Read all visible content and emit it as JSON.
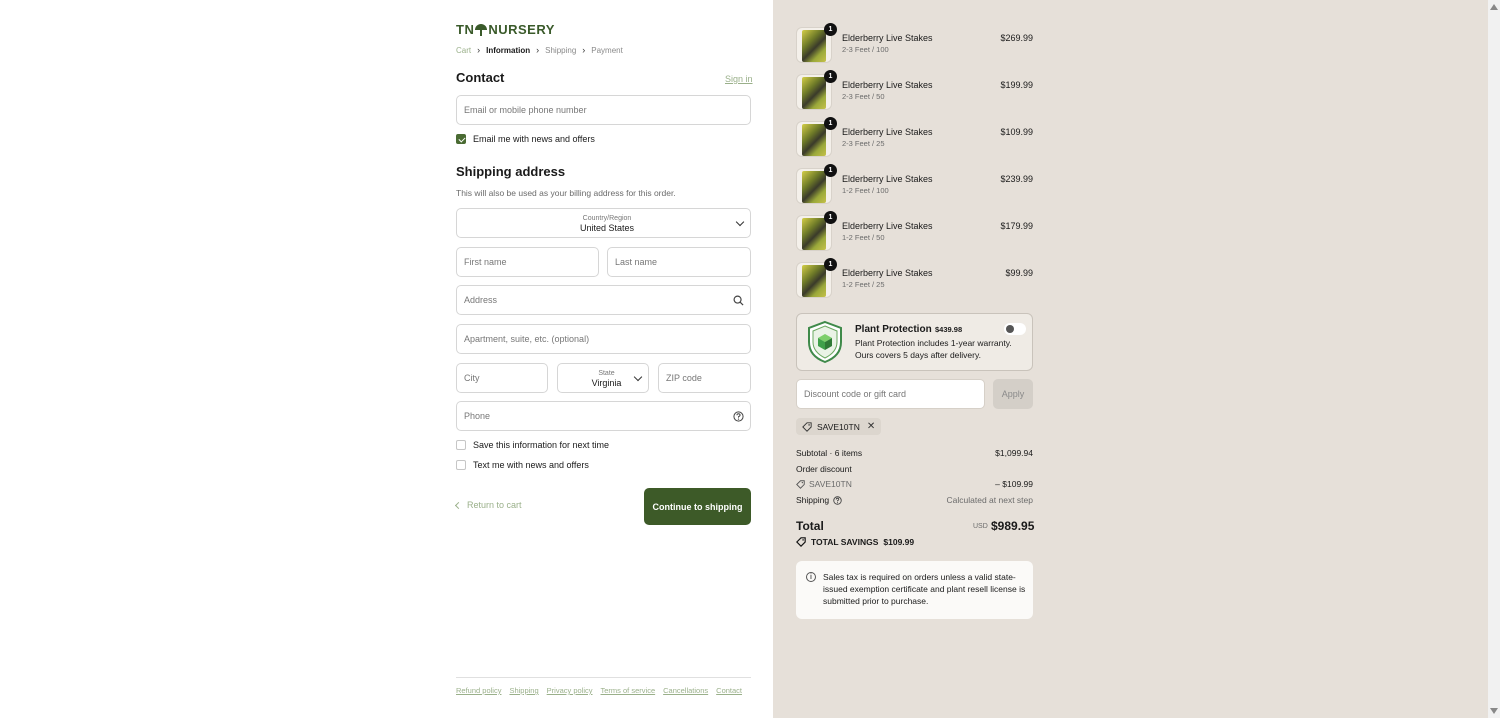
{
  "brand": {
    "logo_left": "TN",
    "logo_right": "NURSERY"
  },
  "breadcrumb": {
    "cart": "Cart",
    "information": "Information",
    "shipping": "Shipping",
    "payment": "Payment"
  },
  "contact": {
    "heading": "Contact",
    "sign_in": "Sign in",
    "email_placeholder": "Email or mobile phone number",
    "email_news_label": "Email me with news and offers",
    "email_news_checked": true
  },
  "shipping_address": {
    "heading": "Shipping address",
    "note": "This will also be used as your billing address for this order.",
    "country_label": "Country/Region",
    "country_value": "United States",
    "first_name_placeholder": "First name",
    "last_name_placeholder": "Last name",
    "address_placeholder": "Address",
    "apartment_placeholder": "Apartment, suite, etc. (optional)",
    "city_placeholder": "City",
    "state_label": "State",
    "state_value": "Virginia",
    "zip_placeholder": "ZIP code",
    "phone_placeholder": "Phone",
    "save_info_label": "Save this information for next time",
    "text_news_label": "Text me with news and offers"
  },
  "actions": {
    "return_label": "Return to cart",
    "continue_label": "Continue to shipping"
  },
  "footer": {
    "links": [
      "Refund policy",
      "Shipping",
      "Privacy policy",
      "Terms of service",
      "Cancellations",
      "Contact"
    ]
  },
  "order": {
    "items": [
      {
        "qty": "1",
        "name": "Elderberry Live Stakes",
        "variant": "2-3 Feet / 100",
        "price": "$269.99"
      },
      {
        "qty": "1",
        "name": "Elderberry Live Stakes",
        "variant": "2-3 Feet / 50",
        "price": "$199.99"
      },
      {
        "qty": "1",
        "name": "Elderberry Live Stakes",
        "variant": "2-3 Feet / 25",
        "price": "$109.99"
      },
      {
        "qty": "1",
        "name": "Elderberry Live Stakes",
        "variant": "1-2 Feet / 100",
        "price": "$239.99"
      },
      {
        "qty": "1",
        "name": "Elderberry Live Stakes",
        "variant": "1-2 Feet / 50",
        "price": "$179.99"
      },
      {
        "qty": "1",
        "name": "Elderberry Live Stakes",
        "variant": "1-2 Feet / 25",
        "price": "$99.99"
      }
    ],
    "protection": {
      "title": "Plant Protection",
      "price": "$439.98",
      "desc_line1": "Plant Protection includes 1-year warranty.",
      "desc_line2": "Ours covers 5 days after delivery.",
      "enabled": false
    },
    "discount_placeholder": "Discount code or gift card",
    "apply_label": "Apply",
    "applied_code": "SAVE10TN",
    "subtotal_label": "Subtotal · 6 items",
    "subtotal_value": "$1,099.94",
    "order_discount_label": "Order discount",
    "discount_code": "SAVE10TN",
    "discount_value": "– $109.99",
    "shipping_label": "Shipping",
    "shipping_value": "Calculated at next step",
    "total_label": "Total",
    "currency": "USD",
    "total_value": "$989.95",
    "savings_label": "TOTAL SAVINGS",
    "savings_value": "$109.99",
    "tax_note": "Sales tax is required on orders unless a valid state-issued exemption certificate and plant resell license is submitted prior to purchase."
  },
  "colors": {
    "brand_green": "#3d5a28",
    "link_green": "#9ab08a",
    "summary_bg": "#e6e0d9"
  }
}
